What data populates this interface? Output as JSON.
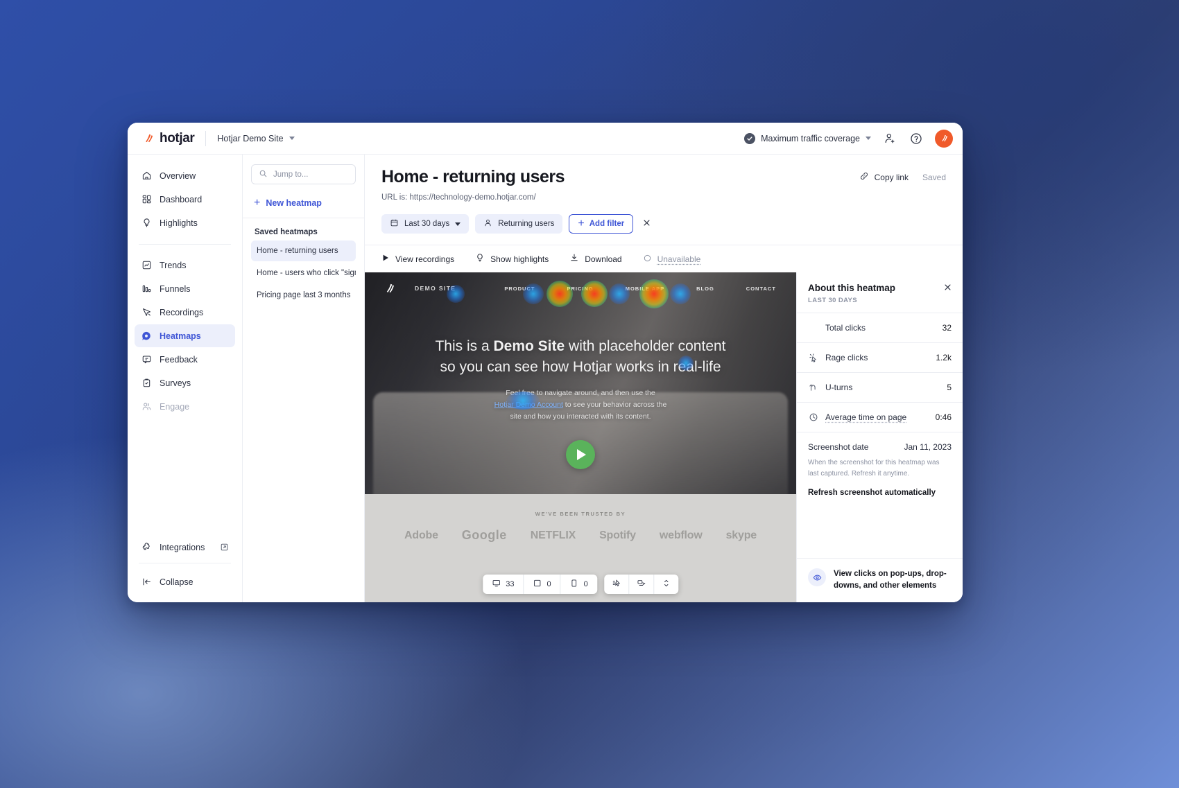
{
  "topbar": {
    "logo_text": "hotjar",
    "site_name": "Hotjar Demo Site",
    "coverage_label": "Maximum traffic coverage",
    "invite_icon": "add-user-icon",
    "help_icon": "help-circle-icon",
    "avatar_icon": "hotjar-avatar"
  },
  "sidebar": {
    "groups": [
      {
        "items": [
          {
            "label": "Overview",
            "icon": "home-icon",
            "state": "normal"
          },
          {
            "label": "Dashboard",
            "icon": "dashboard-grid-icon",
            "state": "normal"
          },
          {
            "label": "Highlights",
            "icon": "lightbulb-icon",
            "state": "normal"
          }
        ]
      },
      {
        "items": [
          {
            "label": "Trends",
            "icon": "trends-chart-icon",
            "state": "normal"
          },
          {
            "label": "Funnels",
            "icon": "funnels-bars-icon",
            "state": "normal"
          },
          {
            "label": "Recordings",
            "icon": "recordings-cursor-icon",
            "state": "normal"
          },
          {
            "label": "Heatmaps",
            "icon": "heatmap-icon",
            "state": "active"
          },
          {
            "label": "Feedback",
            "icon": "feedback-chat-icon",
            "state": "normal"
          },
          {
            "label": "Surveys",
            "icon": "surveys-clipboard-icon",
            "state": "normal"
          },
          {
            "label": "Engage",
            "icon": "engage-users-icon",
            "state": "disabled"
          }
        ]
      }
    ],
    "integrations_label": "Integrations",
    "integrations_icon": "puzzle-icon",
    "external_icon": "external-link-icon",
    "collapse_label": "Collapse",
    "collapse_icon": "collapse-left-icon"
  },
  "list_panel": {
    "search_placeholder": "Jump to...",
    "search_value": "",
    "search_icon": "search-icon",
    "new_heatmap_label": "New heatmap",
    "saved_section_label": "Saved heatmaps",
    "heatmaps": [
      {
        "label": "Home - returning users",
        "active": true
      },
      {
        "label": "Home - users who click \"sign up\"",
        "active": false
      },
      {
        "label": "Pricing page last 3 months",
        "active": false
      }
    ]
  },
  "main": {
    "title": "Home - returning users",
    "url_line": "URL is: https://technology-demo.hotjar.com/",
    "copy_link_label": "Copy link",
    "copy_link_icon": "link-icon",
    "saved_status": "Saved",
    "filters": {
      "date_range": "Last 30 days",
      "date_icon": "calendar-icon",
      "segment": "Returning users",
      "segment_icon": "user-icon",
      "add_filter_label": "Add filter",
      "clear_icon": "close-icon"
    },
    "toolbar": [
      {
        "label": "View recordings",
        "icon": "play-icon",
        "disabled": false
      },
      {
        "label": "Show highlights",
        "icon": "lightbulb-icon",
        "disabled": false
      },
      {
        "label": "Download",
        "icon": "download-icon",
        "disabled": false
      },
      {
        "label": "Unavailable",
        "icon": "circle-icon",
        "disabled": true
      }
    ]
  },
  "preview": {
    "nav_brand": "DEMO SITE",
    "nav_links": [
      "PRODUCT",
      "PRICING",
      "MOBILE APP",
      "BLOG",
      "CONTACT"
    ],
    "headline_a": "This is a ",
    "headline_b": "Demo Site",
    "headline_c": " with placeholder content",
    "headline_d": "so you can see how Hotjar works in real-life",
    "sub_a": "Feel free to navigate around, and then use the",
    "sub_link": "Hotjar Demo Account",
    "sub_b": " to see your behavior across the",
    "sub_c": "site and how you interacted with its content.",
    "trusted_label": "WE'VE BEEN TRUSTED BY",
    "trusted_logos": [
      "Adobe",
      "Google",
      "NETFLIX",
      "Spotify",
      "webflow",
      "skype"
    ],
    "play_icon": "play-icon"
  },
  "player_bar": {
    "desktop_icon": "desktop-icon",
    "desktop_count": "33",
    "tablet_icon": "tablet-icon",
    "tablet_count": "0",
    "mobile_icon": "mobile-icon",
    "mobile_count": "0",
    "tool_icons": [
      "click-map-icon",
      "move-map-icon",
      "scroll-map-icon"
    ]
  },
  "about_panel": {
    "title": "About this heatmap",
    "subtitle": "LAST 30 DAYS",
    "close_icon": "close-icon",
    "metrics": [
      {
        "label": "Total clicks",
        "value": "32",
        "icon": "",
        "dotted": false
      },
      {
        "label": "Rage clicks",
        "value": "1.2k",
        "icon": "rage-click-icon",
        "dotted": false
      },
      {
        "label": "U-turns",
        "value": "5",
        "icon": "u-turn-icon",
        "dotted": false
      },
      {
        "label": "Average time on page",
        "value": "0:46",
        "icon": "clock-icon",
        "dotted": true
      }
    ],
    "screenshot_label": "Screenshot date",
    "screenshot_value": "Jan 11, 2023",
    "screenshot_note": "When the screenshot for this heatmap was last captured. Refresh it anytime.",
    "refresh_label": "Refresh screenshot automatically",
    "footer_text": "View clicks on pop-ups, drop-downs, and other elements",
    "footer_icon": "eye-reveal-icon"
  },
  "colors": {
    "accent": "#3f56d6",
    "brand_orange": "#f05a2a",
    "text": "#2b3040",
    "muted": "#8d93a3",
    "chip_bg": "#eceffb",
    "play_green": "#5ab35b"
  }
}
